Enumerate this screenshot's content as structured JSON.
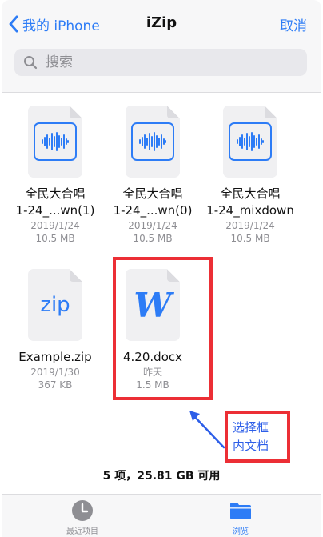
{
  "nav": {
    "back_label": "我的 iPhone",
    "title": "iZip",
    "cancel_label": "取消"
  },
  "search": {
    "placeholder": "搜索"
  },
  "files": [
    {
      "name_line1": "全民大合唱",
      "name_line2": "1-24_...wn(1)",
      "date": "2019/1/24",
      "size": "10.5 MB",
      "icon": "audio-file-icon"
    },
    {
      "name_line1": "全民大合唱",
      "name_line2": "1-24_...wn(0)",
      "date": "2019/1/24",
      "size": "10.5 MB",
      "icon": "audio-file-icon"
    },
    {
      "name_line1": "全民大合唱",
      "name_line2": "1-24_mixdown",
      "date": "2019/1/24",
      "size": "10.5 MB",
      "icon": "audio-file-icon"
    },
    {
      "name_line1": "Example.zip",
      "date": "2019/1/30",
      "size": "367 KB",
      "icon": "zip-file-icon",
      "glyph": "zip"
    },
    {
      "name_line1": "4.20.docx",
      "date": "昨天",
      "size": "1.5 MB",
      "icon": "word-file-icon",
      "glyph": "W"
    }
  ],
  "annotation": {
    "line1": "选择框",
    "line2": "内文档"
  },
  "summary": "5 项，25.81 GB 可用",
  "tabs": [
    {
      "label": "最近项目",
      "icon": "clock-icon",
      "active": false
    },
    {
      "label": "浏览",
      "icon": "folder-icon",
      "active": true
    }
  ],
  "colors": {
    "accent": "#2d7cf6",
    "highlight": "#ec2f35",
    "inactive": "#8e8e93"
  }
}
